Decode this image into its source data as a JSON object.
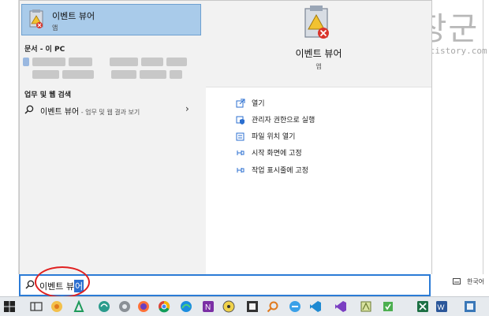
{
  "watermark": {
    "text": "녹두장군",
    "url": "http://mainia.tistory.com"
  },
  "best_match": {
    "title": "이벤트 뷰어",
    "subtitle": "앱"
  },
  "sections": {
    "documents": "문서 - 이 PC",
    "web": "업무 및 웹 검색"
  },
  "web_result": {
    "query": "이벤트 뷰어",
    "suffix": " - 업무 및 웹 결과 보기",
    "chevron": "›"
  },
  "preview": {
    "title": "이벤트 뷰어",
    "subtitle": "앱"
  },
  "actions": [
    {
      "label": "열기",
      "icon": "open-icon"
    },
    {
      "label": "관리자 권한으로 실행",
      "icon": "shield-icon"
    },
    {
      "label": "파일 위치 열기",
      "icon": "folder-icon"
    },
    {
      "label": "시작 화면에 고정",
      "icon": "pin-icon"
    },
    {
      "label": "작업 표시줄에 고정",
      "icon": "pin-icon"
    }
  ],
  "search": {
    "value_before_caret": "이벤트 뷰",
    "caret_char": "어"
  },
  "tray": {
    "language": "한국어"
  },
  "colors": {
    "accent": "#2b7bd6",
    "selection": "#a9cbea",
    "highlight": "#e02020",
    "taskbar": "#e6eaee"
  }
}
